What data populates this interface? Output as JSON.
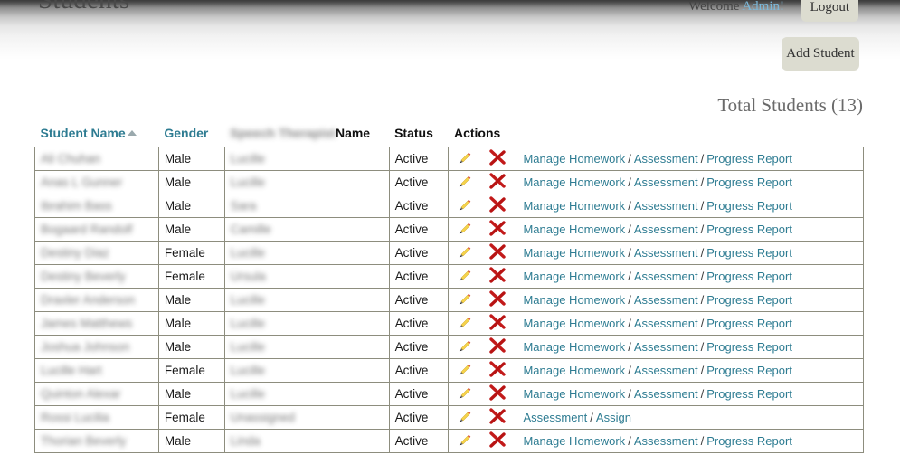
{
  "header": {
    "page_title": "Students",
    "welcome_text": "Welcome",
    "admin_label": "Admin!",
    "logout_label": "Logout"
  },
  "toolbar": {
    "add_student_label": "Add Student"
  },
  "summary": {
    "total_students": "Total Students (13)"
  },
  "table": {
    "columns": {
      "student_name": "Student Name",
      "gender": "Gender",
      "therapist_redacted": "Speech Therapist",
      "therapist_name": "Name",
      "status": "Status",
      "actions": "Actions"
    },
    "icons": {
      "sort_asc": "sort-ascending-arrow",
      "edit": "pencil-edit-icon",
      "delete": "red-x-delete-icon"
    },
    "links": {
      "manage_homework": "Manage Homework",
      "assessment": "Assessment",
      "progress_report": "Progress Report",
      "assign": "Assign",
      "separator": "/"
    },
    "rows": [
      {
        "name": "Ali Chuhan",
        "gender": "Male",
        "therapist": "Lucille",
        "status": "Active",
        "actions": "full"
      },
      {
        "name": "Anas L Gunner",
        "gender": "Male",
        "therapist": "Lucille",
        "status": "Active",
        "actions": "full"
      },
      {
        "name": "Ibrahim Bass",
        "gender": "Male",
        "therapist": "Sara",
        "status": "Active",
        "actions": "full"
      },
      {
        "name": "Bogaard Randolf",
        "gender": "Male",
        "therapist": "Camille",
        "status": "Active",
        "actions": "full"
      },
      {
        "name": "Destiny Diaz",
        "gender": "Female",
        "therapist": "Lucille",
        "status": "Active",
        "actions": "full"
      },
      {
        "name": "Destiny Beverly",
        "gender": "Female",
        "therapist": "Ursula",
        "status": "Active",
        "actions": "full"
      },
      {
        "name": "Draxler Anderson",
        "gender": "Male",
        "therapist": "Lucille",
        "status": "Active",
        "actions": "full"
      },
      {
        "name": "James Matthews",
        "gender": "Male",
        "therapist": "Lucille",
        "status": "Active",
        "actions": "full"
      },
      {
        "name": "Joshua Johnson",
        "gender": "Male",
        "therapist": "Lucille",
        "status": "Active",
        "actions": "full"
      },
      {
        "name": "Lucille Hart",
        "gender": "Female",
        "therapist": "Lucille",
        "status": "Active",
        "actions": "full"
      },
      {
        "name": "Quinton Alexar",
        "gender": "Male",
        "therapist": "Lucille",
        "status": "Active",
        "actions": "full"
      },
      {
        "name": "Rossi Lucilia",
        "gender": "Female",
        "therapist": "Unassigned",
        "status": "Active",
        "actions": "assign"
      },
      {
        "name": "Thorian Beverly",
        "gender": "Male",
        "therapist": "Linda",
        "status": "Active",
        "actions": "full"
      }
    ]
  },
  "colors": {
    "link": "#2e7c92",
    "admin_link": "#7bb8d9",
    "button_bg": "#dcdcd0",
    "border": "#8d8d7e",
    "delete_icon": "#c21a1a",
    "edit_icon": "#f2c230"
  }
}
